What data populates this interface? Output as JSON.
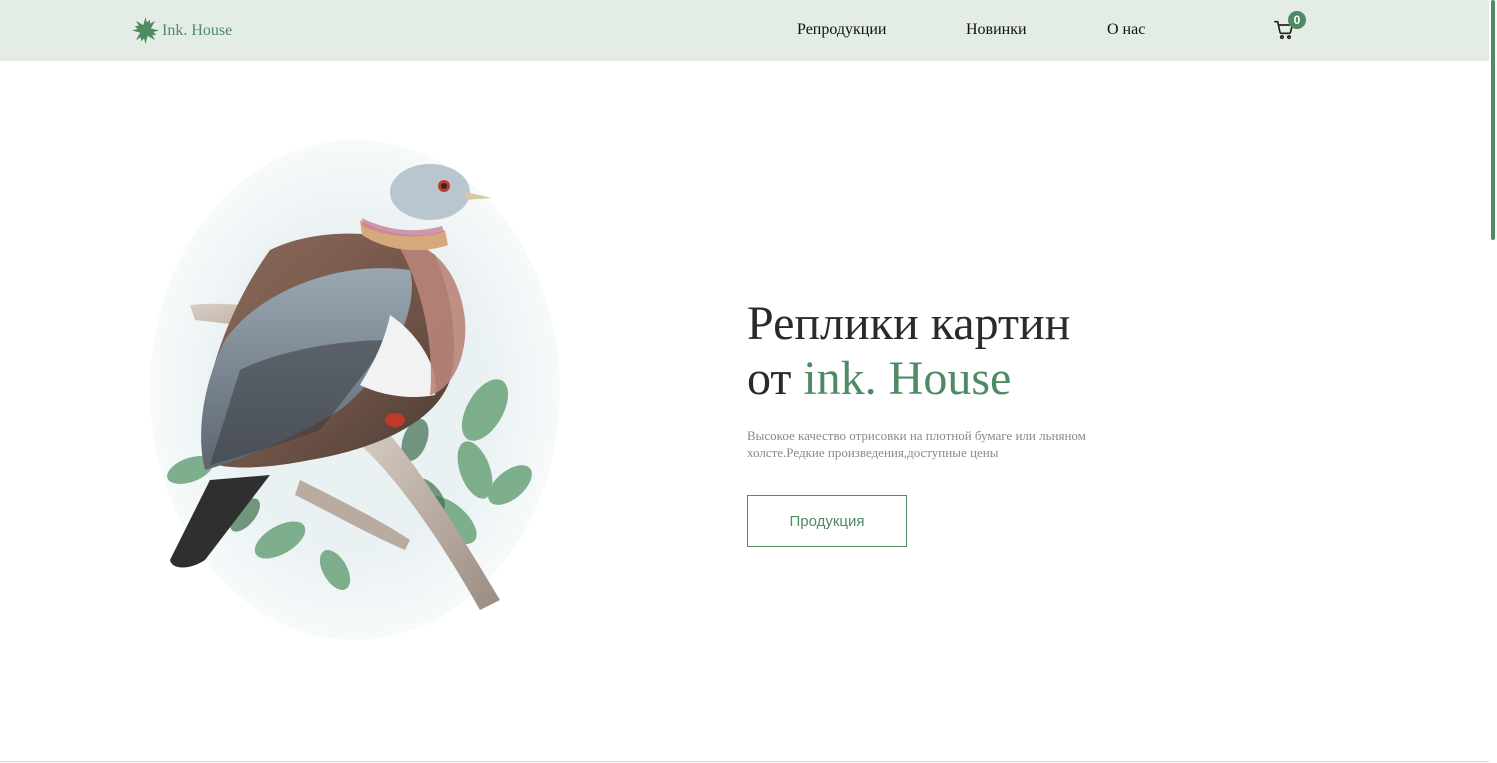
{
  "header": {
    "logo_text": "Ink. House",
    "nav": {
      "reproductions": "Репродукции",
      "new_arrivals": "Новинки",
      "about": "О нас"
    },
    "cart": {
      "count": "0",
      "icon": "cart-icon"
    }
  },
  "hero": {
    "title_line1": "Реплики картин",
    "title_prefix": "от",
    "title_accent": "ink. House",
    "description": "Высокое качество отрисовки на плотной бумаге или льняном холсте.Редкие произведения,доступные цены",
    "button_label": "Продукция",
    "image": "pigeon-illustration"
  },
  "colors": {
    "header_bg": "#e3ede5",
    "accent": "#4e8a62",
    "text_dark": "#2a2a2a",
    "text_muted": "#8a8a8a"
  }
}
